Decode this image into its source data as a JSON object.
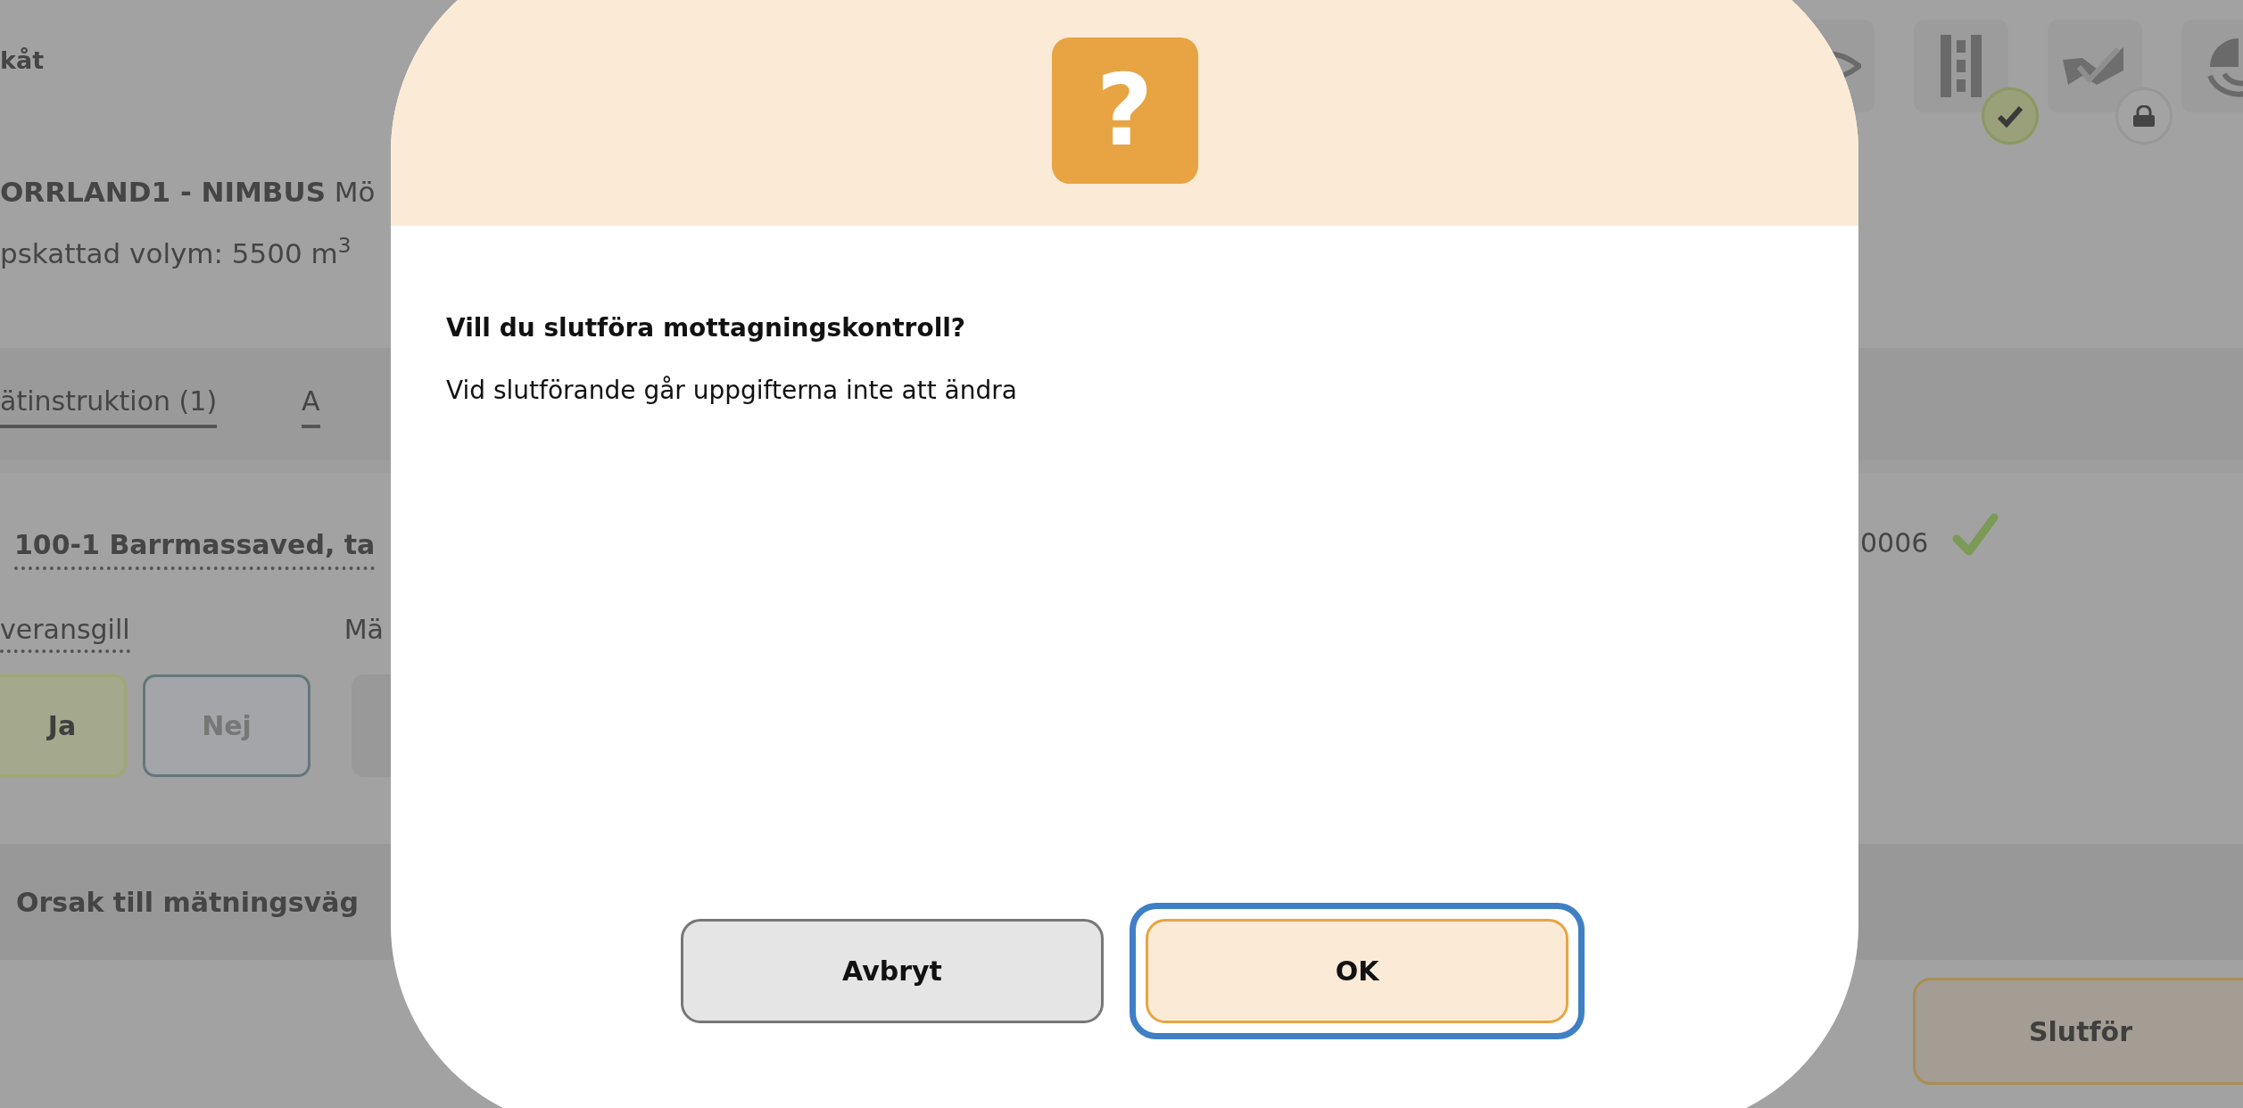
{
  "header": {
    "title": "kåt"
  },
  "toolbar": [
    {
      "checked": false,
      "locked": false
    },
    {
      "checked": true,
      "locked": false
    },
    {
      "checked": false,
      "locked": true
    },
    {
      "checked": false,
      "locked": false
    }
  ],
  "order": {
    "name": "ORRLAND1 - NIMBUS",
    "detail": "Mö",
    "volume": "pskattad volym: 5500 m$^{3}$"
  },
  "tabs": [
    {
      "label": "ätinstruktion (1)"
    },
    {
      "label": "A"
    }
  ],
  "assortment": {
    "title": "100-1 Barrmassaved, ta",
    "code": "0006",
    "verified": true
  },
  "fields": [
    {
      "label": "veransgill"
    },
    {
      "label": "Mä"
    }
  ],
  "choices": [
    {
      "label": "Ja",
      "selected": true
    },
    {
      "label": "Nej",
      "selected": false
    }
  ],
  "section": {
    "title": "Orsak till mätningsväg"
  },
  "finish_button": {
    "label": "Slutför"
  },
  "dialog": {
    "icon": "?",
    "title": "Vill du slutföra mottagningskontroll?",
    "message": "Vid slutförande går uppgifterna inte att ändra",
    "buttons": [
      {
        "label": "Avbryt",
        "kind": "secondary",
        "focused": false
      },
      {
        "label": "OK",
        "kind": "primary",
        "focused": true
      }
    ]
  }
}
